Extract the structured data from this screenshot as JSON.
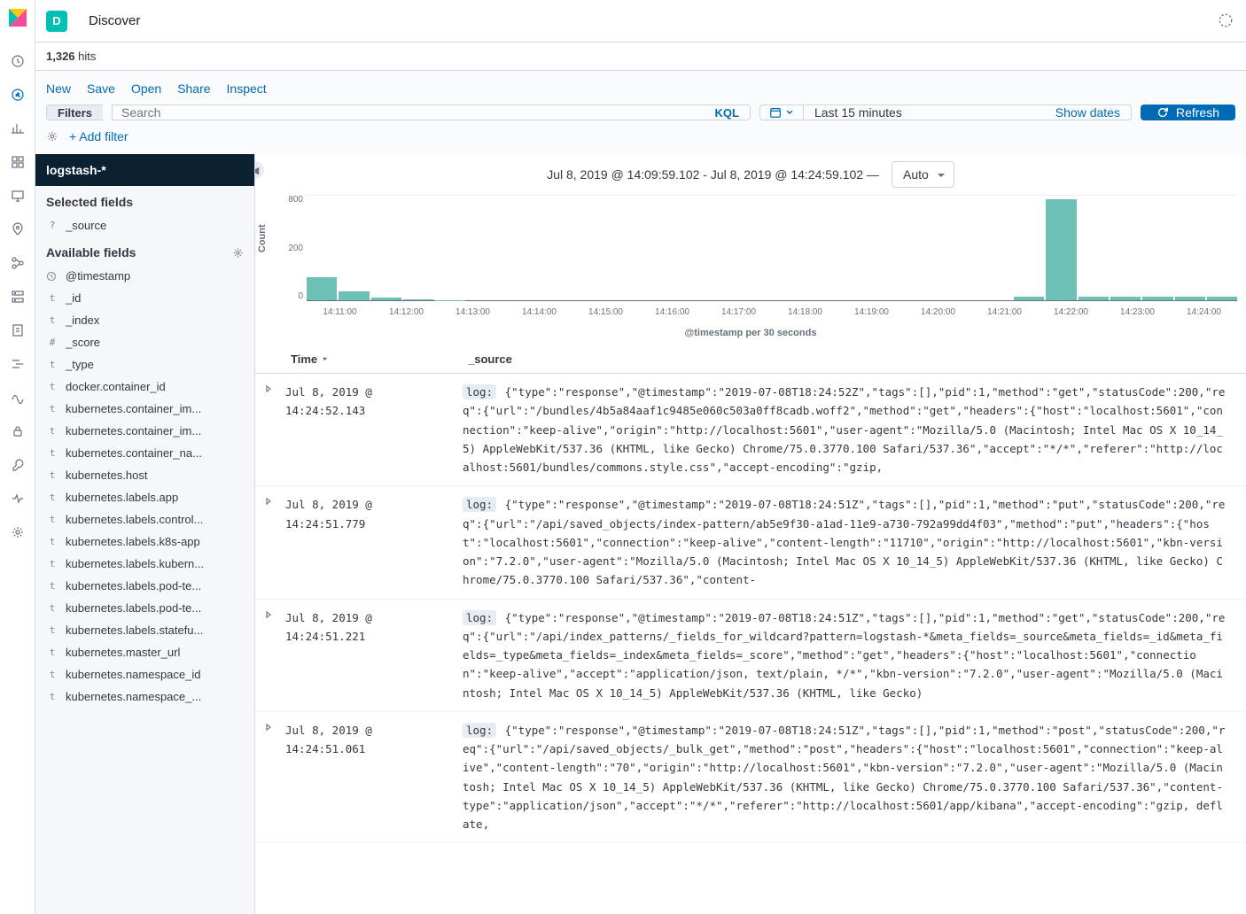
{
  "header": {
    "app_letter": "D",
    "app_title": "Discover"
  },
  "hits": {
    "count": "1,326",
    "label": "hits"
  },
  "actions": {
    "new": "New",
    "save": "Save",
    "open": "Open",
    "share": "Share",
    "inspect": "Inspect"
  },
  "query": {
    "filters_label": "Filters",
    "search_placeholder": "Search",
    "kql": "KQL",
    "date_range": "Last 15 minutes",
    "show_dates": "Show dates",
    "refresh": "Refresh",
    "add_filter": "+ Add filter"
  },
  "sidebar": {
    "index_pattern": "logstash-*",
    "selected_header": "Selected fields",
    "available_header": "Available fields",
    "selected_fields": [
      {
        "type": "?",
        "name": "_source"
      }
    ],
    "available_fields": [
      {
        "type": "clock",
        "name": "@timestamp"
      },
      {
        "type": "t",
        "name": "_id"
      },
      {
        "type": "t",
        "name": "_index"
      },
      {
        "type": "#",
        "name": "_score"
      },
      {
        "type": "t",
        "name": "_type"
      },
      {
        "type": "t",
        "name": "docker.container_id"
      },
      {
        "type": "t",
        "name": "kubernetes.container_im..."
      },
      {
        "type": "t",
        "name": "kubernetes.container_im..."
      },
      {
        "type": "t",
        "name": "kubernetes.container_na..."
      },
      {
        "type": "t",
        "name": "kubernetes.host"
      },
      {
        "type": "t",
        "name": "kubernetes.labels.app"
      },
      {
        "type": "t",
        "name": "kubernetes.labels.control..."
      },
      {
        "type": "t",
        "name": "kubernetes.labels.k8s-app"
      },
      {
        "type": "t",
        "name": "kubernetes.labels.kubern..."
      },
      {
        "type": "t",
        "name": "kubernetes.labels.pod-te..."
      },
      {
        "type": "t",
        "name": "kubernetes.labels.pod-te..."
      },
      {
        "type": "t",
        "name": "kubernetes.labels.statefu..."
      },
      {
        "type": "t",
        "name": "kubernetes.master_url"
      },
      {
        "type": "t",
        "name": "kubernetes.namespace_id"
      },
      {
        "type": "t",
        "name": "kubernetes.namespace_..."
      }
    ]
  },
  "chart_header": {
    "range_text": "Jul 8, 2019 @ 14:09:59.102 - Jul 8, 2019 @ 14:24:59.102 —",
    "interval": "Auto"
  },
  "chart_data": {
    "type": "bar",
    "ylabel": "Count",
    "xlabel": "@timestamp per 30 seconds",
    "ylim": [
      0,
      900
    ],
    "y_ticks": [
      "0",
      "200",
      "800"
    ],
    "x_ticks": [
      "14:11:00",
      "14:12:00",
      "14:13:00",
      "14:14:00",
      "14:15:00",
      "14:16:00",
      "14:17:00",
      "14:18:00",
      "14:19:00",
      "14:20:00",
      "14:21:00",
      "14:22:00",
      "14:23:00",
      "14:24:00"
    ],
    "values": [
      200,
      80,
      20,
      10,
      3,
      0,
      0,
      0,
      0,
      0,
      0,
      0,
      0,
      0,
      0,
      0,
      0,
      0,
      0,
      0,
      0,
      0,
      30,
      870,
      30,
      30,
      30,
      30,
      30
    ]
  },
  "table": {
    "col_time": "Time",
    "col_source": "_source",
    "rows": [
      {
        "time": "Jul 8, 2019 @ 14:24:52.143",
        "label": "log:",
        "source": "{\"type\":\"response\",\"@timestamp\":\"2019-07-08T18:24:52Z\",\"tags\":[],\"pid\":1,\"method\":\"get\",\"statusCode\":200,\"req\":{\"url\":\"/bundles/4b5a84aaf1c9485e060c503a0ff8cadb.woff2\",\"method\":\"get\",\"headers\":{\"host\":\"localhost:5601\",\"connection\":\"keep-alive\",\"origin\":\"http://localhost:5601\",\"user-agent\":\"Mozilla/5.0 (Macintosh; Intel Mac OS X 10_14_5) AppleWebKit/537.36 (KHTML, like Gecko) Chrome/75.0.3770.100 Safari/537.36\",\"accept\":\"*/*\",\"referer\":\"http://localhost:5601/bundles/commons.style.css\",\"accept-encoding\":\"gzip,"
      },
      {
        "time": "Jul 8, 2019 @ 14:24:51.779",
        "label": "log:",
        "source": "{\"type\":\"response\",\"@timestamp\":\"2019-07-08T18:24:51Z\",\"tags\":[],\"pid\":1,\"method\":\"put\",\"statusCode\":200,\"req\":{\"url\":\"/api/saved_objects/index-pattern/ab5e9f30-a1ad-11e9-a730-792a99dd4f03\",\"method\":\"put\",\"headers\":{\"host\":\"localhost:5601\",\"connection\":\"keep-alive\",\"content-length\":\"11710\",\"origin\":\"http://localhost:5601\",\"kbn-version\":\"7.2.0\",\"user-agent\":\"Mozilla/5.0 (Macintosh; Intel Mac OS X 10_14_5) AppleWebKit/537.36 (KHTML, like Gecko) Chrome/75.0.3770.100 Safari/537.36\",\"content-"
      },
      {
        "time": "Jul 8, 2019 @ 14:24:51.221",
        "label": "log:",
        "source": "{\"type\":\"response\",\"@timestamp\":\"2019-07-08T18:24:51Z\",\"tags\":[],\"pid\":1,\"method\":\"get\",\"statusCode\":200,\"req\":{\"url\":\"/api/index_patterns/_fields_for_wildcard?pattern=logstash-*&meta_fields=_source&meta_fields=_id&meta_fields=_type&meta_fields=_index&meta_fields=_score\",\"method\":\"get\",\"headers\":{\"host\":\"localhost:5601\",\"connection\":\"keep-alive\",\"accept\":\"application/json, text/plain, */*\",\"kbn-version\":\"7.2.0\",\"user-agent\":\"Mozilla/5.0 (Macintosh; Intel Mac OS X 10_14_5) AppleWebKit/537.36 (KHTML, like Gecko)"
      },
      {
        "time": "Jul 8, 2019 @ 14:24:51.061",
        "label": "log:",
        "source": "{\"type\":\"response\",\"@timestamp\":\"2019-07-08T18:24:51Z\",\"tags\":[],\"pid\":1,\"method\":\"post\",\"statusCode\":200,\"req\":{\"url\":\"/api/saved_objects/_bulk_get\",\"method\":\"post\",\"headers\":{\"host\":\"localhost:5601\",\"connection\":\"keep-alive\",\"content-length\":\"70\",\"origin\":\"http://localhost:5601\",\"kbn-version\":\"7.2.0\",\"user-agent\":\"Mozilla/5.0 (Macintosh; Intel Mac OS X 10_14_5) AppleWebKit/537.36 (KHTML, like Gecko) Chrome/75.0.3770.100 Safari/537.36\",\"content-type\":\"application/json\",\"accept\":\"*/*\",\"referer\":\"http://localhost:5601/app/kibana\",\"accept-encoding\":\"gzip, deflate,"
      }
    ]
  }
}
